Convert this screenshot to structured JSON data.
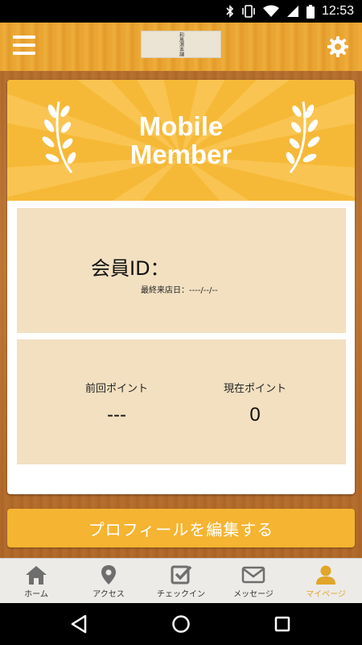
{
  "status_bar": {
    "time": "12:53",
    "icons": [
      "bluetooth-icon",
      "vibrate-icon",
      "wifi-icon",
      "signal-icon",
      "battery-icon"
    ]
  },
  "header": {
    "menu_icon": "hamburger-menu-icon",
    "settings_icon": "gear-icon",
    "logo_text": "和風湯本舗"
  },
  "card": {
    "banner": {
      "title_line1": "Mobile",
      "title_line2": "Member"
    },
    "member": {
      "id_label": "会員ID：",
      "id_value": "",
      "last_visit_label": "最終来店日：",
      "last_visit_value": "----/--/--"
    },
    "points": {
      "previous_label": "前回ポイント",
      "previous_value": "---",
      "current_label": "現在ポイント",
      "current_value": "0"
    }
  },
  "edit_profile_label": "プロフィールを編集する",
  "tabs": [
    {
      "label": "ホーム",
      "icon": "home-icon",
      "active": false
    },
    {
      "label": "アクセス",
      "icon": "map-pin-icon",
      "active": false
    },
    {
      "label": "チェックイン",
      "icon": "checkbox-icon",
      "active": false
    },
    {
      "label": "メッセージ",
      "icon": "envelope-icon",
      "active": false
    },
    {
      "label": "マイページ",
      "icon": "person-icon",
      "active": true
    }
  ],
  "nav_bar": {
    "icons": [
      "back-icon",
      "home-circle-icon",
      "recents-icon"
    ]
  },
  "colors": {
    "accent": "#f5b431",
    "banner": "#f6b937",
    "panel": "#f2e0c1",
    "active_tab": "#e1a52a"
  }
}
